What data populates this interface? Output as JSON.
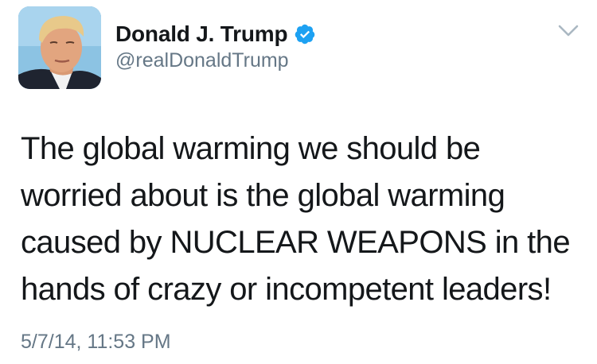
{
  "tweet": {
    "author": {
      "display_name": "Donald J. Trump",
      "handle": "@realDonaldTrump",
      "avatar_icon": "profile-photo",
      "verified_icon": "verified-badge-icon",
      "verified_color": "#1da1f2"
    },
    "text": "The global warming we should be\nworried about is the global warming\ncaused by NUCLEAR WEAPONS in the\nhands of crazy or incompetent leaders!",
    "timestamp": "5/7/14, 11:53 PM",
    "menu_icon": "chevron-down-icon"
  },
  "colors": {
    "text": "#14171a",
    "secondary_text": "#657786",
    "chevron": "#aab8c2",
    "background": "#ffffff"
  }
}
